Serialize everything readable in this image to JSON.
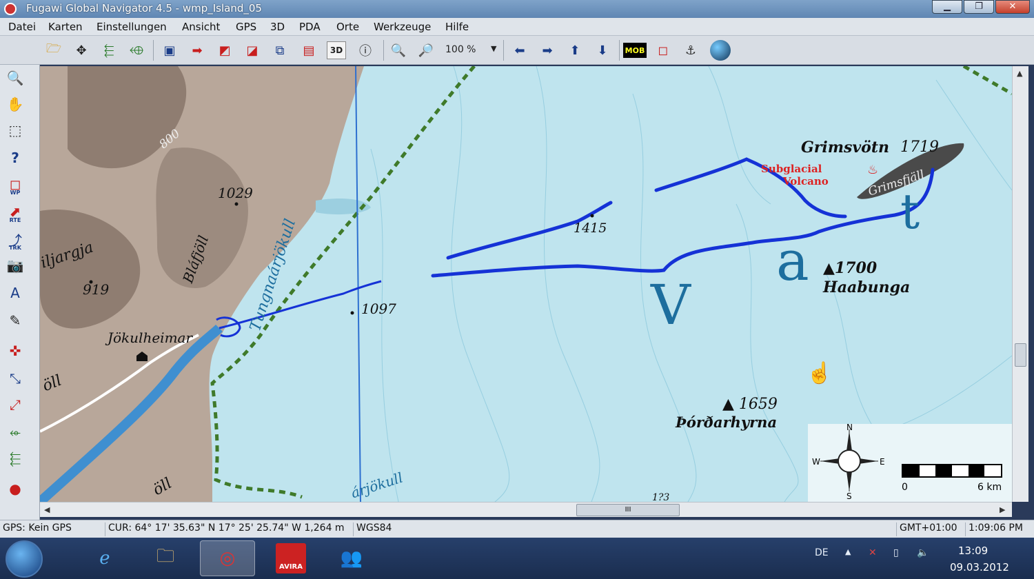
{
  "window": {
    "title": "Fugawi Global Navigator 4.5 - wmp_Island_05",
    "minimize_glyph": "▁",
    "maximize_glyph": "❐",
    "close_glyph": "✕"
  },
  "menu": [
    "Datei",
    "Karten",
    "Einstellungen",
    "Ansicht",
    "GPS",
    "3D",
    "PDA",
    "Orte",
    "Werkzeuge",
    "Hilfe"
  ],
  "toolbar": {
    "zoom_value": "100 %",
    "button_3d": "3D",
    "button_mob": "MOB",
    "icons": [
      "open-folder-icon",
      "move-icon",
      "layer-up-icon",
      "layer-down-icon",
      "gps-window-icon",
      "track-export-icon",
      "waypoint-box-icon",
      "route-box-icon",
      "route-icon",
      "map-frame-icon",
      "3d-icon",
      "info-icon",
      "zoom-out-icon",
      "zoom-in-icon",
      "arrow-left-icon",
      "arrow-right-icon",
      "arrow-up-icon",
      "arrow-down-icon",
      "mob-icon",
      "select-box-icon",
      "anchor-icon",
      "google-earth-icon"
    ]
  },
  "left_tools": {
    "wp": "WP",
    "rte": "RTE",
    "trk": "TRK"
  },
  "map": {
    "labels": {
      "grimsvotn": "Grimsvötn",
      "grimsvotn_elev": "1719",
      "subglacial": "Subglacial",
      "volcano": "Volcano",
      "grimsfjall": "Grimsfjäll",
      "haabunga_elev": "▲1700",
      "haabunga": "Haabunga",
      "tordarhyrna_elev": "▲ 1659",
      "tordarhyrna": "Þórðarhyrna",
      "p1415": "1415",
      "p1097": "1097",
      "p1029": "1029",
      "p919": "919",
      "contour_800": "800",
      "blafjoll": "Bláfjöll",
      "jokulheimar": "Jökulheimar",
      "tungnaarjokull": "Tungnaárjökull",
      "arjokull": "árjökull",
      "jargja": "iljargja",
      "oll_left": "öll",
      "oll_bottom": "öll",
      "v_letter": "V",
      "a_letter": "a",
      "t_letter": "t",
      "partial_bottom": "1?3"
    },
    "compass": {
      "n": "N",
      "s": "S",
      "w": "W",
      "e": "E"
    },
    "scale": {
      "start": "0",
      "end": "6 km"
    }
  },
  "scroll": {
    "h_thumb": "III"
  },
  "status": {
    "gps": "GPS: Kein GPS",
    "cursor": "CUR: 64° 17' 35.63\" N 17° 25' 25.74\" W  1,264 m",
    "datum": "WGS84",
    "timezone": "GMT+01:00",
    "time": "1:09:06 PM"
  },
  "taskbar": {
    "language": "DE",
    "clock_time": "13:09",
    "clock_date": "09.03.2012",
    "avira": "AVIRA"
  },
  "colors": {
    "glacier": "#bfe4ee",
    "land": "#b8a79a",
    "track": "#1532d6",
    "boundary": "#3f7a2a"
  }
}
